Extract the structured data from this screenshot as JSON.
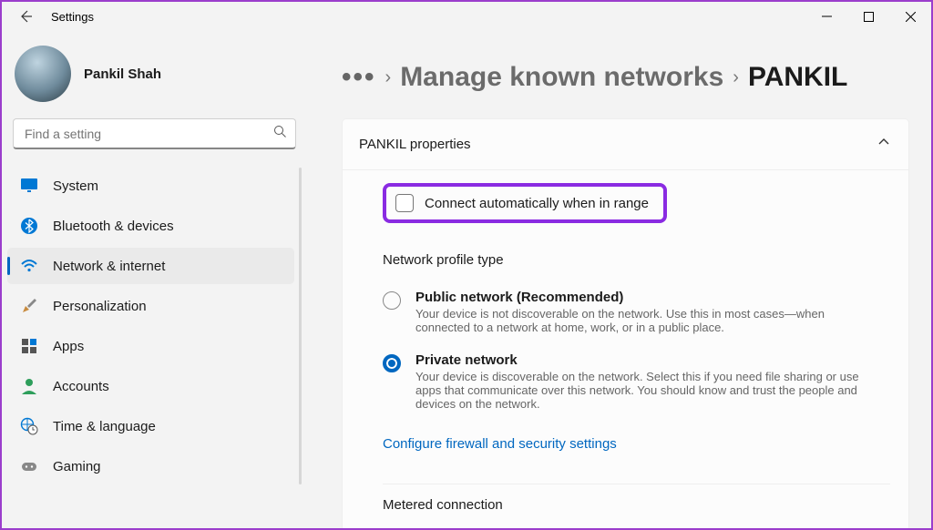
{
  "window": {
    "title": "Settings"
  },
  "user": {
    "name": "Pankil Shah"
  },
  "search": {
    "placeholder": "Find a setting"
  },
  "nav": {
    "items": [
      {
        "icon": "monitor-icon",
        "label": "System"
      },
      {
        "icon": "bluetooth-icon",
        "label": "Bluetooth & devices"
      },
      {
        "icon": "wifi-icon",
        "label": "Network & internet",
        "active": true
      },
      {
        "icon": "brush-icon",
        "label": "Personalization"
      },
      {
        "icon": "apps-icon",
        "label": "Apps"
      },
      {
        "icon": "person-icon",
        "label": "Accounts"
      },
      {
        "icon": "globe-clock-icon",
        "label": "Time & language"
      },
      {
        "icon": "gamepad-icon",
        "label": "Gaming"
      }
    ]
  },
  "breadcrumb": {
    "more": "•••",
    "mid": "Manage known networks",
    "current": "PANKIL"
  },
  "panel": {
    "title": "PANKIL properties",
    "auto_connect": "Connect automatically when in range",
    "profile_title": "Network profile type",
    "public": {
      "label": "Public network (Recommended)",
      "desc": "Your device is not discoverable on the network. Use this in most cases—when connected to a network at home, work, or in a public place."
    },
    "private": {
      "label": "Private network",
      "desc": "Your device is discoverable on the network. Select this if you need file sharing or use apps that communicate over this network. You should know and trust the people and devices on the network."
    },
    "firewall_link": "Configure firewall and security settings",
    "metered": "Metered connection"
  }
}
